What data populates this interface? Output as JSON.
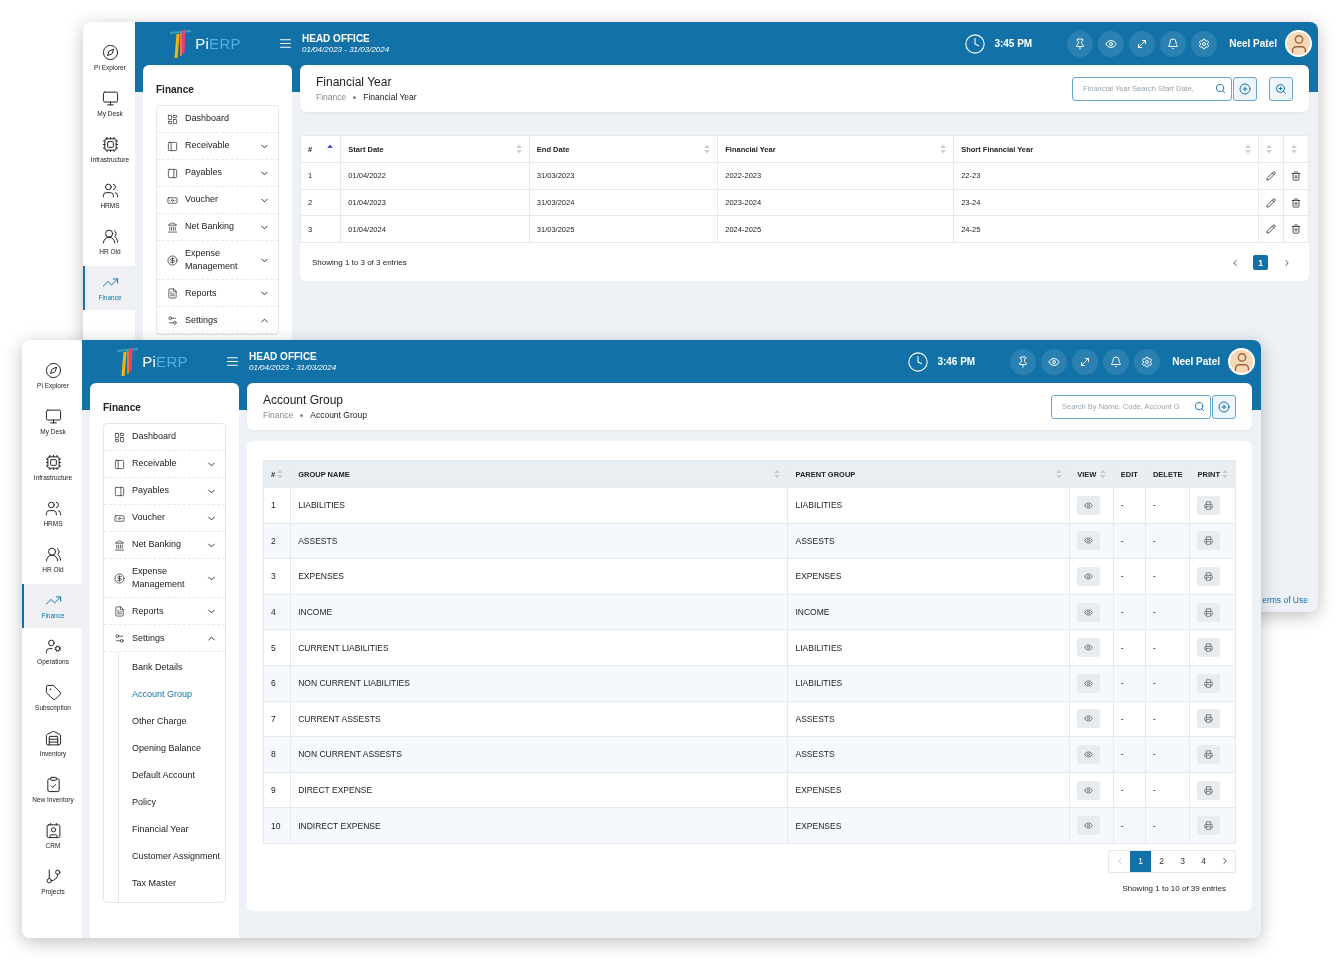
{
  "windows": [
    {
      "kind": "back",
      "logo": {
        "prefix": "Pi",
        "suffix": "ERP"
      },
      "office": "HEAD OFFICE",
      "period": "01/04/2023 - 31/03/2024",
      "time": "3:45 PM",
      "user": "Neel Patel",
      "rail": [
        {
          "label": "Pi Explorer",
          "selected": false
        },
        {
          "label": "My Desk",
          "selected": false
        },
        {
          "label": "Infrastructure",
          "selected": false
        },
        {
          "label": "HRMS",
          "selected": false
        },
        {
          "label": "HR Old",
          "selected": false
        },
        {
          "label": "Finance",
          "selected": true
        }
      ],
      "menu": {
        "title": "Finance",
        "items": [
          {
            "label": "Dashboard",
            "kind": "link"
          },
          {
            "label": "Receivable",
            "kind": "group",
            "expanded": false
          },
          {
            "label": "Payables",
            "kind": "group",
            "expanded": false
          },
          {
            "label": "Voucher",
            "kind": "group",
            "expanded": false
          },
          {
            "label": "Net Banking",
            "kind": "group",
            "expanded": false
          },
          {
            "label": "Expense Management",
            "kind": "group",
            "expanded": false
          },
          {
            "label": "Reports",
            "kind": "group",
            "expanded": false
          },
          {
            "label": "Settings",
            "kind": "group",
            "expanded": true
          }
        ]
      },
      "page": {
        "title": "Financial Year",
        "breadcrumb": [
          "Finance",
          "Financial Year"
        ],
        "search_placeholder": "Financial Year Search Start Date,",
        "actions": [
          {
            "kind": "add"
          },
          {
            "kind": "zoom"
          }
        ]
      },
      "table": {
        "columns": [
          {
            "label": "#",
            "kind": "text",
            "sortable": true,
            "sorted": true
          },
          {
            "label": "Start Date",
            "kind": "text",
            "sortable": true,
            "sorted": false
          },
          {
            "label": "End Date",
            "kind": "text",
            "sortable": true,
            "sorted": false
          },
          {
            "label": "Financial Year",
            "kind": "text",
            "sortable": true,
            "sorted": false
          },
          {
            "label": "Short Financial Year",
            "kind": "text",
            "sortable": true,
            "sorted": false
          },
          {
            "kind": "edit",
            "sortable": true,
            "sorted": false
          },
          {
            "kind": "delete",
            "sortable": true,
            "sorted": false
          }
        ],
        "rows": [
          {
            "cells": [
              "1",
              "01/04/2022",
              "31/03/2023",
              "2022-2023",
              "22-23"
            ]
          },
          {
            "cells": [
              "2",
              "01/04/2023",
              "31/03/2024",
              "2023-2024",
              "23-24"
            ]
          },
          {
            "cells": [
              "3",
              "01/04/2024",
              "31/03/2025",
              "2024-2025",
              "24-25"
            ]
          }
        ]
      },
      "summary": "Showing 1 to 3 of 3 entries",
      "pages": [
        {
          "label": "1",
          "selected": true
        }
      ],
      "terms": "erms of Use"
    },
    {
      "kind": "front",
      "logo": {
        "prefix": "Pi",
        "suffix": "ERP"
      },
      "office": "HEAD OFFICE",
      "period": "01/04/2023 - 31/03/2024",
      "time": "3:46 PM",
      "user": "Neel Patel",
      "rail": [
        {
          "label": "Pi Explorer",
          "selected": false
        },
        {
          "label": "My Desk",
          "selected": false
        },
        {
          "label": "Infrastructure",
          "selected": false
        },
        {
          "label": "HRMS",
          "selected": false
        },
        {
          "label": "HR Old",
          "selected": false
        },
        {
          "label": "Finance",
          "selected": true
        },
        {
          "label": "Operations",
          "selected": false
        },
        {
          "label": "Subscription",
          "selected": false
        },
        {
          "label": "Inventory",
          "selected": false
        },
        {
          "label": "New Inventory",
          "selected": false
        },
        {
          "label": "CRM",
          "selected": false
        },
        {
          "label": "Projects",
          "selected": false
        }
      ],
      "menu": {
        "title": "Finance",
        "items": [
          {
            "label": "Dashboard",
            "kind": "link"
          },
          {
            "label": "Receivable",
            "kind": "group",
            "expanded": false
          },
          {
            "label": "Payables",
            "kind": "group",
            "expanded": false
          },
          {
            "label": "Voucher",
            "kind": "group",
            "expanded": false
          },
          {
            "label": "Net Banking",
            "kind": "group",
            "expanded": false
          },
          {
            "label": "Expense Management",
            "kind": "group",
            "expanded": false
          },
          {
            "label": "Reports",
            "kind": "group",
            "expanded": false
          },
          {
            "label": "Settings",
            "kind": "group",
            "expanded": true,
            "children": [
              {
                "label": "Bank Details",
                "selected": false
              },
              {
                "label": "Account Group",
                "selected": true
              },
              {
                "label": "Other Charge",
                "selected": false
              },
              {
                "label": "Opening Balance",
                "selected": false
              },
              {
                "label": "Default Account",
                "selected": false
              },
              {
                "label": "Policy",
                "selected": false
              },
              {
                "label": "Financial Year",
                "selected": false
              },
              {
                "label": "Customer Assignment",
                "selected": false
              },
              {
                "label": "Tax Master",
                "selected": false
              }
            ]
          }
        ]
      },
      "page": {
        "title": "Account Group",
        "breadcrumb": [
          "Finance",
          "Account Group"
        ],
        "search_placeholder": "Search By Name, Code, Account G",
        "actions": [
          {
            "kind": "add"
          }
        ]
      },
      "table": {
        "columns": [
          {
            "label": "#",
            "kind": "text",
            "sortable": true,
            "sorted": false
          },
          {
            "label": "GROUP NAME",
            "kind": "text",
            "sortable": true,
            "sorted": false
          },
          {
            "label": "PARENT GROUP",
            "kind": "text",
            "sortable": true,
            "sorted": false
          },
          {
            "label": "VIEW",
            "kind": "view",
            "sortable": true,
            "sorted": false
          },
          {
            "label": "EDIT",
            "kind": "text",
            "sortable": false
          },
          {
            "label": "DELETE",
            "kind": "text",
            "sortable": false
          },
          {
            "label": "PRINT",
            "kind": "print",
            "sortable": true,
            "sorted": false
          }
        ],
        "rows": [
          {
            "cells": [
              "1",
              "LIABILITIES",
              "LIABILITIES",
              "",
              "-",
              "-"
            ]
          },
          {
            "cells": [
              "2",
              "ASSESTS",
              "ASSESTS",
              "",
              "-",
              "-"
            ]
          },
          {
            "cells": [
              "3",
              "EXPENSES",
              "EXPENSES",
              "",
              "-",
              "-"
            ]
          },
          {
            "cells": [
              "4",
              "INCOME",
              "INCOME",
              "",
              "-",
              "-"
            ]
          },
          {
            "cells": [
              "5",
              "CURRENT LIABILITIES",
              "LIABILITIES",
              "",
              "-",
              "-"
            ]
          },
          {
            "cells": [
              "6",
              "NON CURRENT LIABILITIES",
              "LIABILITIES",
              "",
              "-",
              "-"
            ]
          },
          {
            "cells": [
              "7",
              "CURRENT ASSESTS",
              "ASSESTS",
              "",
              "-",
              "-"
            ]
          },
          {
            "cells": [
              "8",
              "NON CURRENT ASSESTS",
              "ASSESTS",
              "",
              "-",
              "-"
            ]
          },
          {
            "cells": [
              "9",
              "DIRECT EXPENSE",
              "EXPENSES",
              "",
              "-",
              "-"
            ]
          },
          {
            "cells": [
              "10",
              "INDIRECT EXPENSE",
              "EXPENSES",
              "",
              "-",
              "-"
            ]
          }
        ]
      },
      "summary": "Showing 1 to 10 of 39 entries",
      "pages": [
        {
          "label": "1",
          "selected": true
        },
        {
          "label": "2",
          "selected": false
        },
        {
          "label": "3",
          "selected": false
        },
        {
          "label": "4",
          "selected": false
        }
      ]
    }
  ]
}
